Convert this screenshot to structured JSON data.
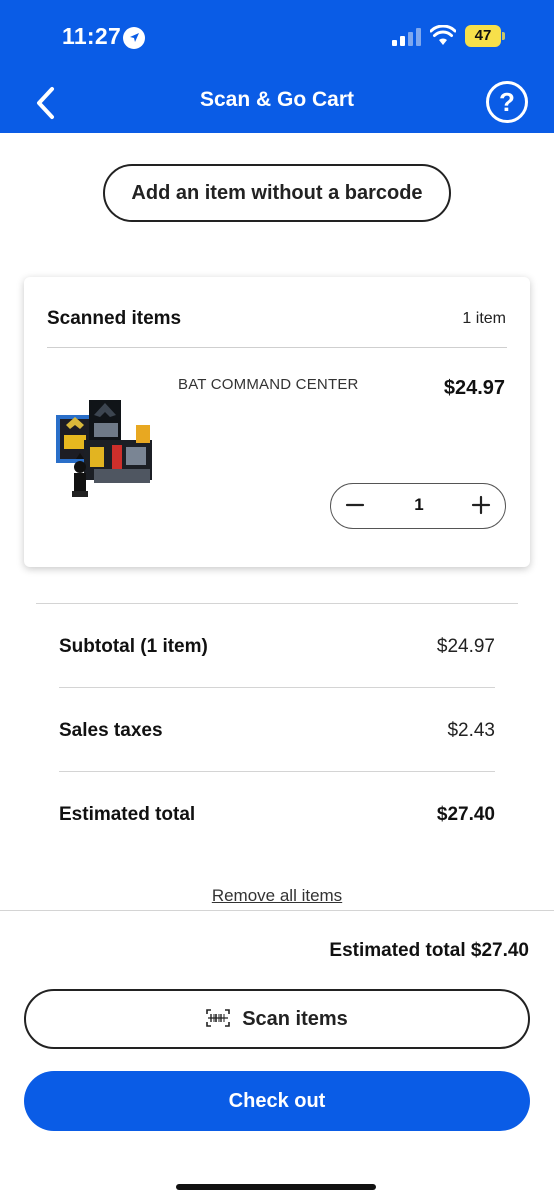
{
  "status_bar": {
    "time": "11:27",
    "battery": "47",
    "icons": [
      "location-arrow-icon",
      "signal-icon",
      "wifi-icon",
      "battery-icon"
    ]
  },
  "nav": {
    "title": "Scan & Go Cart",
    "back_icon": "chevron-left-icon",
    "help_label": "?"
  },
  "actions": {
    "add_without_barcode": "Add an item without a barcode"
  },
  "cart": {
    "title": "Scanned items",
    "count": "1 item",
    "items": [
      {
        "name": "BAT COMMAND CENTER",
        "price": "$24.97",
        "quantity": "1",
        "image": "toy-playset-image"
      }
    ]
  },
  "summary": {
    "subtotal_label": "Subtotal (1 item)",
    "subtotal_value": "$24.97",
    "tax_label": "Sales taxes",
    "tax_value": "$2.43",
    "total_label": "Estimated total",
    "total_value": "$27.40"
  },
  "remove_all": "Remove all items",
  "footer": {
    "estimated_total": "Estimated total $27.40",
    "scan_label": "Scan items",
    "checkout_label": "Check out"
  },
  "colors": {
    "brand_blue": "#0a5ce6",
    "battery_yellow": "#f7e04a"
  }
}
